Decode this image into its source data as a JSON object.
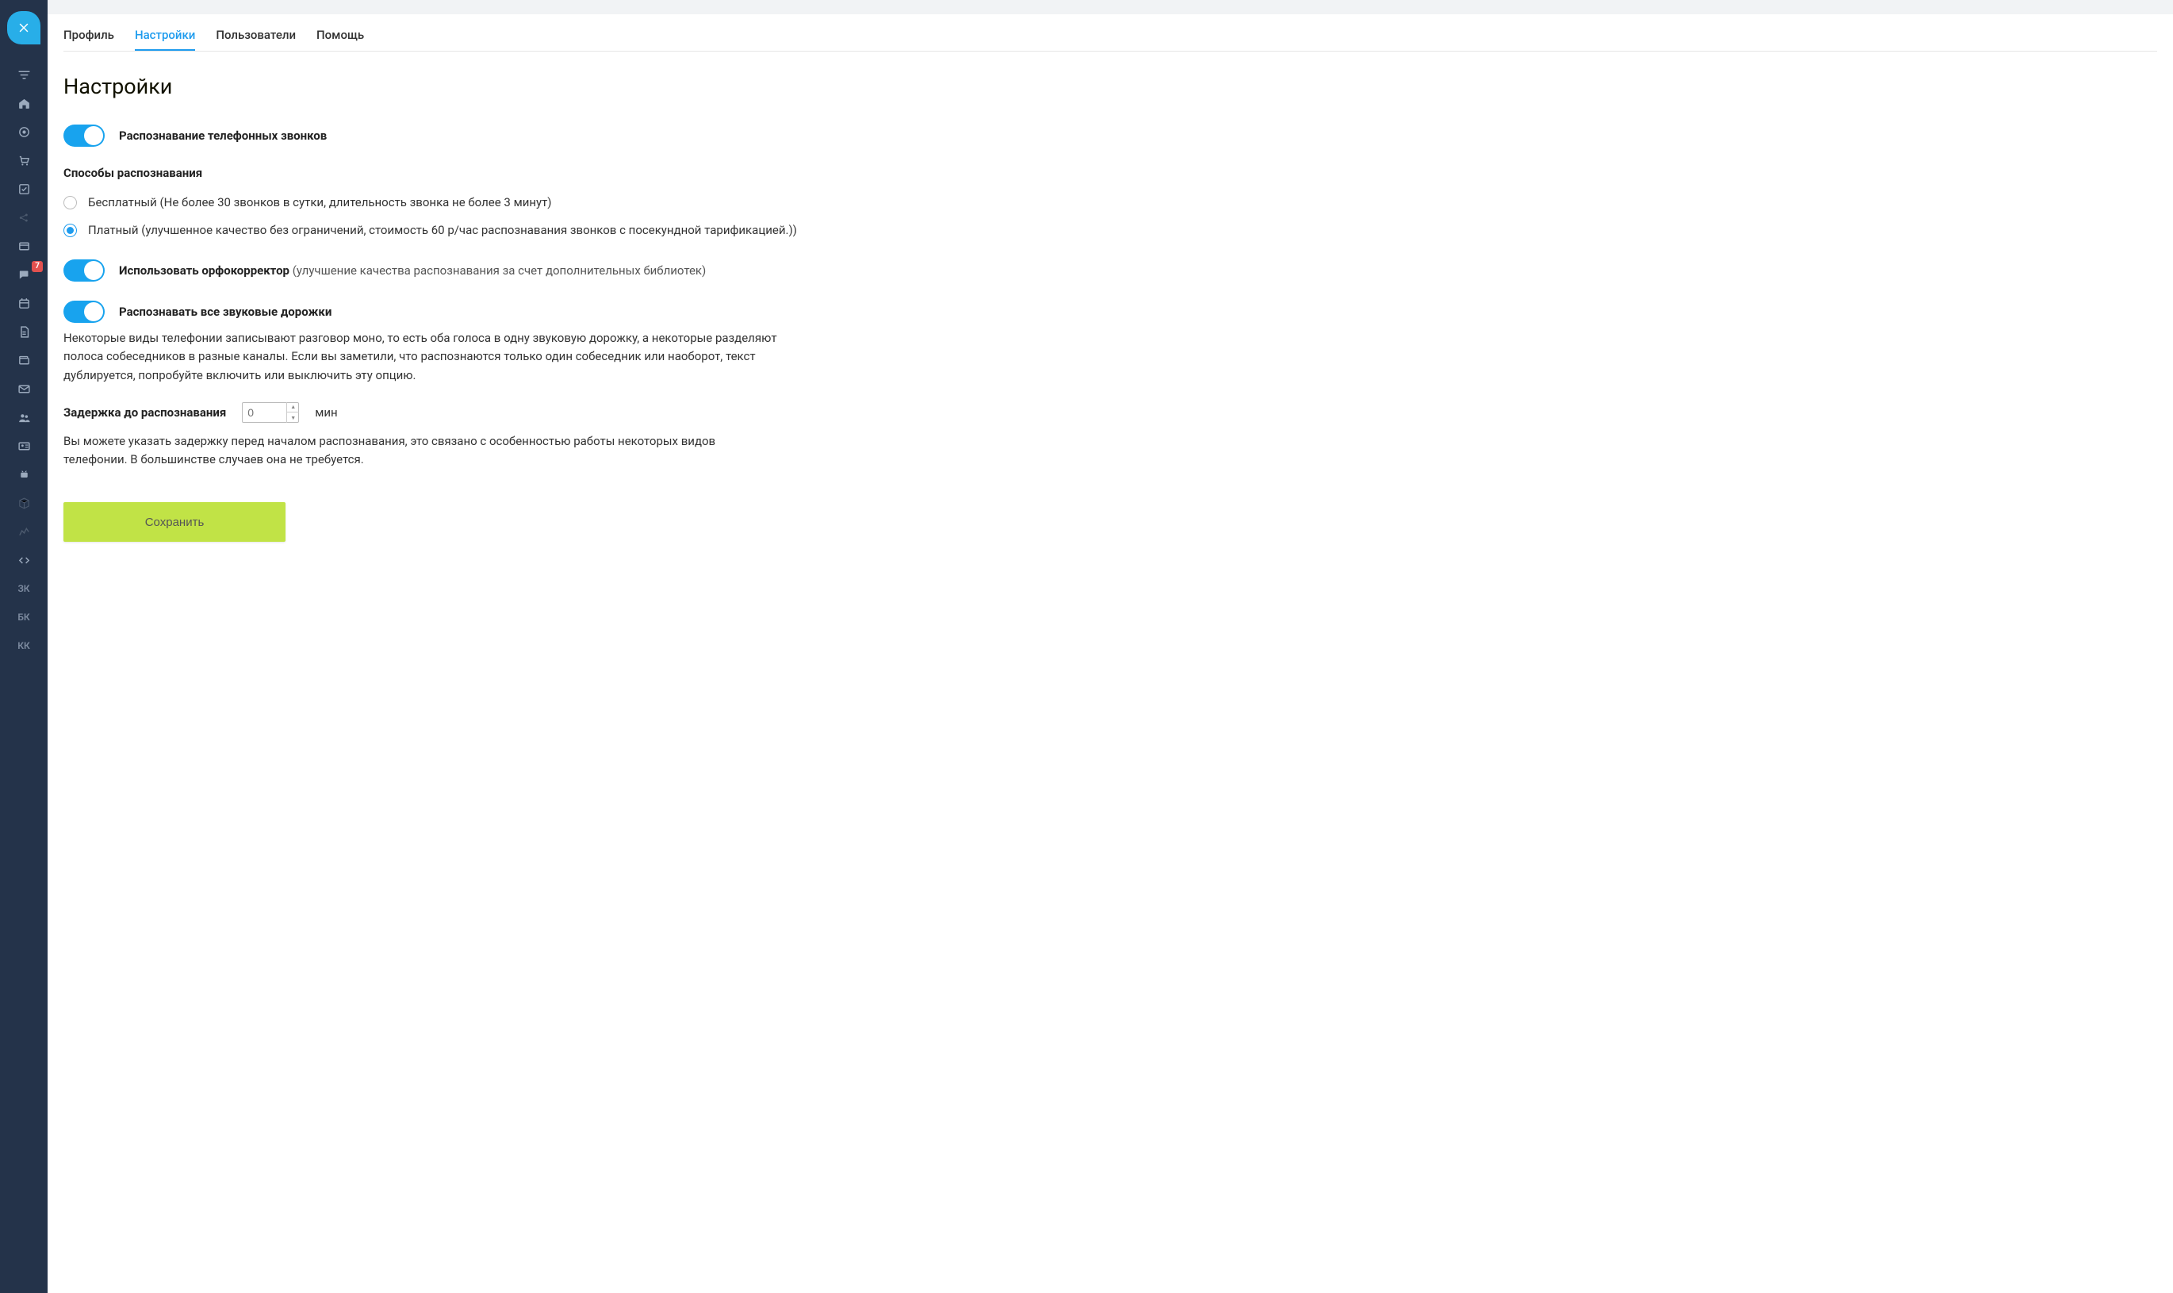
{
  "sidebar": {
    "badge_count": "7",
    "text_items": [
      "ЗК",
      "БК",
      "КК"
    ]
  },
  "tabs": [
    {
      "label": "Профиль",
      "active": false
    },
    {
      "label": "Настройки",
      "active": true
    },
    {
      "label": "Пользователи",
      "active": false
    },
    {
      "label": "Помощь",
      "active": false
    }
  ],
  "page": {
    "title": "Настройки"
  },
  "settings": {
    "toggle_call_recognition": "Распознавание телефонных звонков",
    "recognition_methods_title": "Способы распознавания",
    "radio_free": "Бесплатный (Не более 30 звонков в сутки, длительность звонка не более 3 минут)",
    "radio_paid": "Платный (улучшенное качество без ограничений, стоимость 60 р/час распознавания звонков с посекундной тарификацией.))",
    "toggle_orpho_bold": "Использовать орфокорректор",
    "toggle_orpho_note": " (улучшение качества распознавания за счет дополнительных библиотек)",
    "toggle_all_tracks": "Распознавать все звуковые дорожки",
    "all_tracks_desc": "Некоторые виды телефонии записывают разговор моно, то есть оба голоса в одну звуковую дорожку, а некоторые разделяют полоса собеседников в разные каналы. Если вы заметили, что распознаются только один собеседник или наоборот, текст дублируется, попробуйте включить или выключить эту опцию.",
    "delay_label": "Задержка до распознавания",
    "delay_placeholder": "0",
    "delay_unit": "мин",
    "delay_desc": "Вы можете указать задержку перед началом распознавания, это связано с особенностью работы некоторых видов телефонии. В большинстве случаев она не требуется.",
    "save_button": "Сохранить"
  },
  "colors": {
    "accent": "#18a3ee",
    "sidebar_bg": "#24334a",
    "save_bg": "#c1e346",
    "badge_bg": "#e2514f"
  }
}
